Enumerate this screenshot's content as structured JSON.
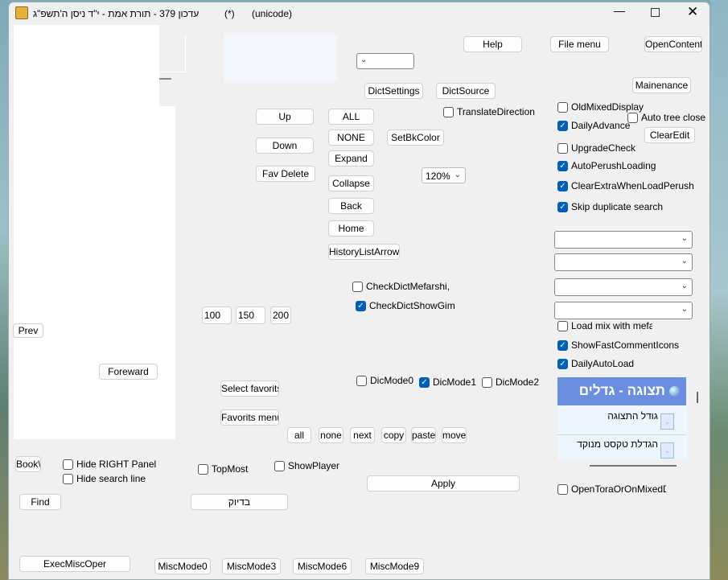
{
  "window": {
    "title": "עדכון 379 - תורת אמת -  י\"ד ניסן ה'תשפ\"ג",
    "modified": "(*)",
    "encoding": "(unicode)"
  },
  "buttons": {
    "help": "Help",
    "file_menu": "File menu",
    "open_contents": "OpenContents",
    "dict_settings": "DictSettings",
    "dict_source": "DictSource",
    "up": "Up",
    "down": "Down",
    "fav_delete": "Fav Delete",
    "all_upper": "ALL",
    "none_upper": "NONE",
    "expand": "Expand",
    "collapse": "Collapse",
    "back": "Back",
    "home": "Home",
    "history": "HistoryListArrow v",
    "set_bk_color": "SetBkColor",
    "maintenance": "Mainenance",
    "clear_edit": "ClearEdit",
    "n100": "100",
    "n150": "150",
    "n200": "200",
    "prev": "Prev",
    "foreward": "Foreward",
    "select_favorits": "Select favorits",
    "favorits_menu": "Favorits menu",
    "all": "all",
    "none": "none",
    "next": "next",
    "copy": "copy",
    "paste": "paste",
    "move": "move",
    "book": "Book\\",
    "find": "Find",
    "exact": "בדיוק",
    "apply": "Apply",
    "exec_misc": "ExecMiscOper",
    "misc0": "MiscMode0",
    "misc3": "MiscMode3",
    "misc6": "MiscMode6",
    "misc9": "MiscMode9"
  },
  "checkboxes": {
    "translate_direction": "TranslateDirection",
    "old_mixed": "OldMixedDisplay",
    "auto_tree_close": "Auto tree close",
    "daily_advance": "DailyAdvance",
    "upgrade_check": "UpgradeCheck",
    "auto_perush": "AutoPerushLoading",
    "clear_extra": "ClearExtraWhenLoadPerush",
    "skip_dup": "Skip duplicate search",
    "check_mefarshi": "CheckDictMefarshi,",
    "check_gim": "CheckDictShowGim",
    "load_mix": "Load mix with mefarsh",
    "show_fast": "ShowFastCommentIcons",
    "daily_auto": "DailyAutoLoad",
    "dic0": "DicMode0",
    "dic1": "DicMode1",
    "dic2": "DicMode2",
    "hide_right": "Hide RIGHT Panel",
    "hide_search": "Hide search line",
    "topmost": "TopMost",
    "show_player": "ShowPlayer",
    "open_tora": "OpenToraOrOnMixedDisp"
  },
  "zoom": {
    "value": "120%"
  },
  "display_panel": {
    "title": "תצוגה - גדלים",
    "rows": [
      "גודל התצוגה",
      "הגדלת טקסט מנוקד"
    ]
  },
  "colors": {
    "accent": "#005fb8",
    "panel_header": "#6a8fe0"
  }
}
